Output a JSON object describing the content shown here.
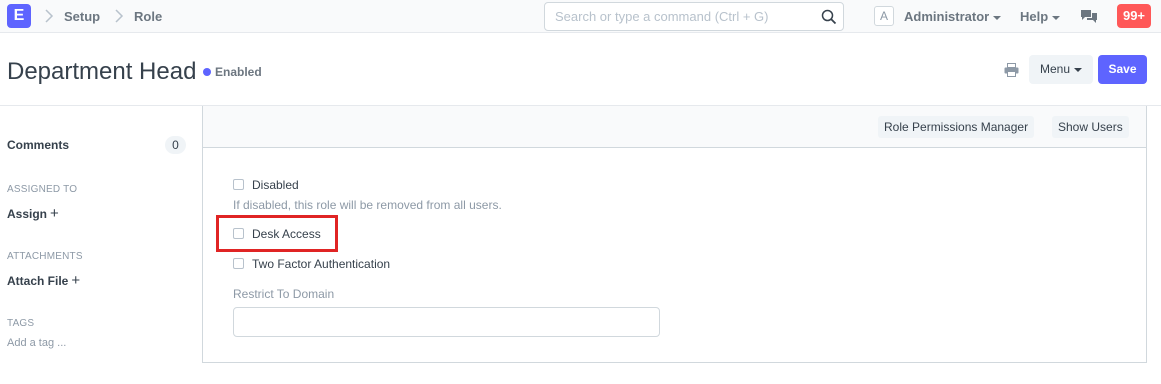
{
  "navbar": {
    "logo": "E",
    "breadcrumbs": [
      "Setup",
      "Role"
    ],
    "search_placeholder": "Search or type a command (Ctrl + G)",
    "avatar_letter": "A",
    "user_label": "Administrator",
    "help_label": "Help",
    "notification_count": "99+"
  },
  "page": {
    "title": "Department Head",
    "status": "Enabled",
    "menu_label": "Menu",
    "save_label": "Save"
  },
  "sidebar": {
    "comments_label": "Comments",
    "comments_count": "0",
    "assigned_to_label": "ASSIGNED TO",
    "assign_link": "Assign",
    "attachments_label": "ATTACHMENTS",
    "attach_link": "Attach File",
    "tags_label": "TAGS",
    "add_tag": "Add a tag ..."
  },
  "form": {
    "toolbar_buttons": [
      "Role Permissions Manager",
      "Show Users"
    ],
    "fields": {
      "disabled": {
        "label": "Disabled",
        "checked": false,
        "help": "If disabled, this role will be removed from all users."
      },
      "desk_access": {
        "label": "Desk Access",
        "checked": false
      },
      "two_factor": {
        "label": "Two Factor Authentication",
        "checked": false
      },
      "restrict_to_domain": {
        "label": "Restrict To Domain",
        "value": ""
      }
    }
  },
  "colors": {
    "primary": "#5e64ff",
    "notification": "#ff5858",
    "highlight": "#e02424"
  },
  "icons": [
    "chevron-right-icon",
    "search-icon",
    "printer-icon",
    "chat-icon",
    "caret-down-icon",
    "plus-icon"
  ]
}
